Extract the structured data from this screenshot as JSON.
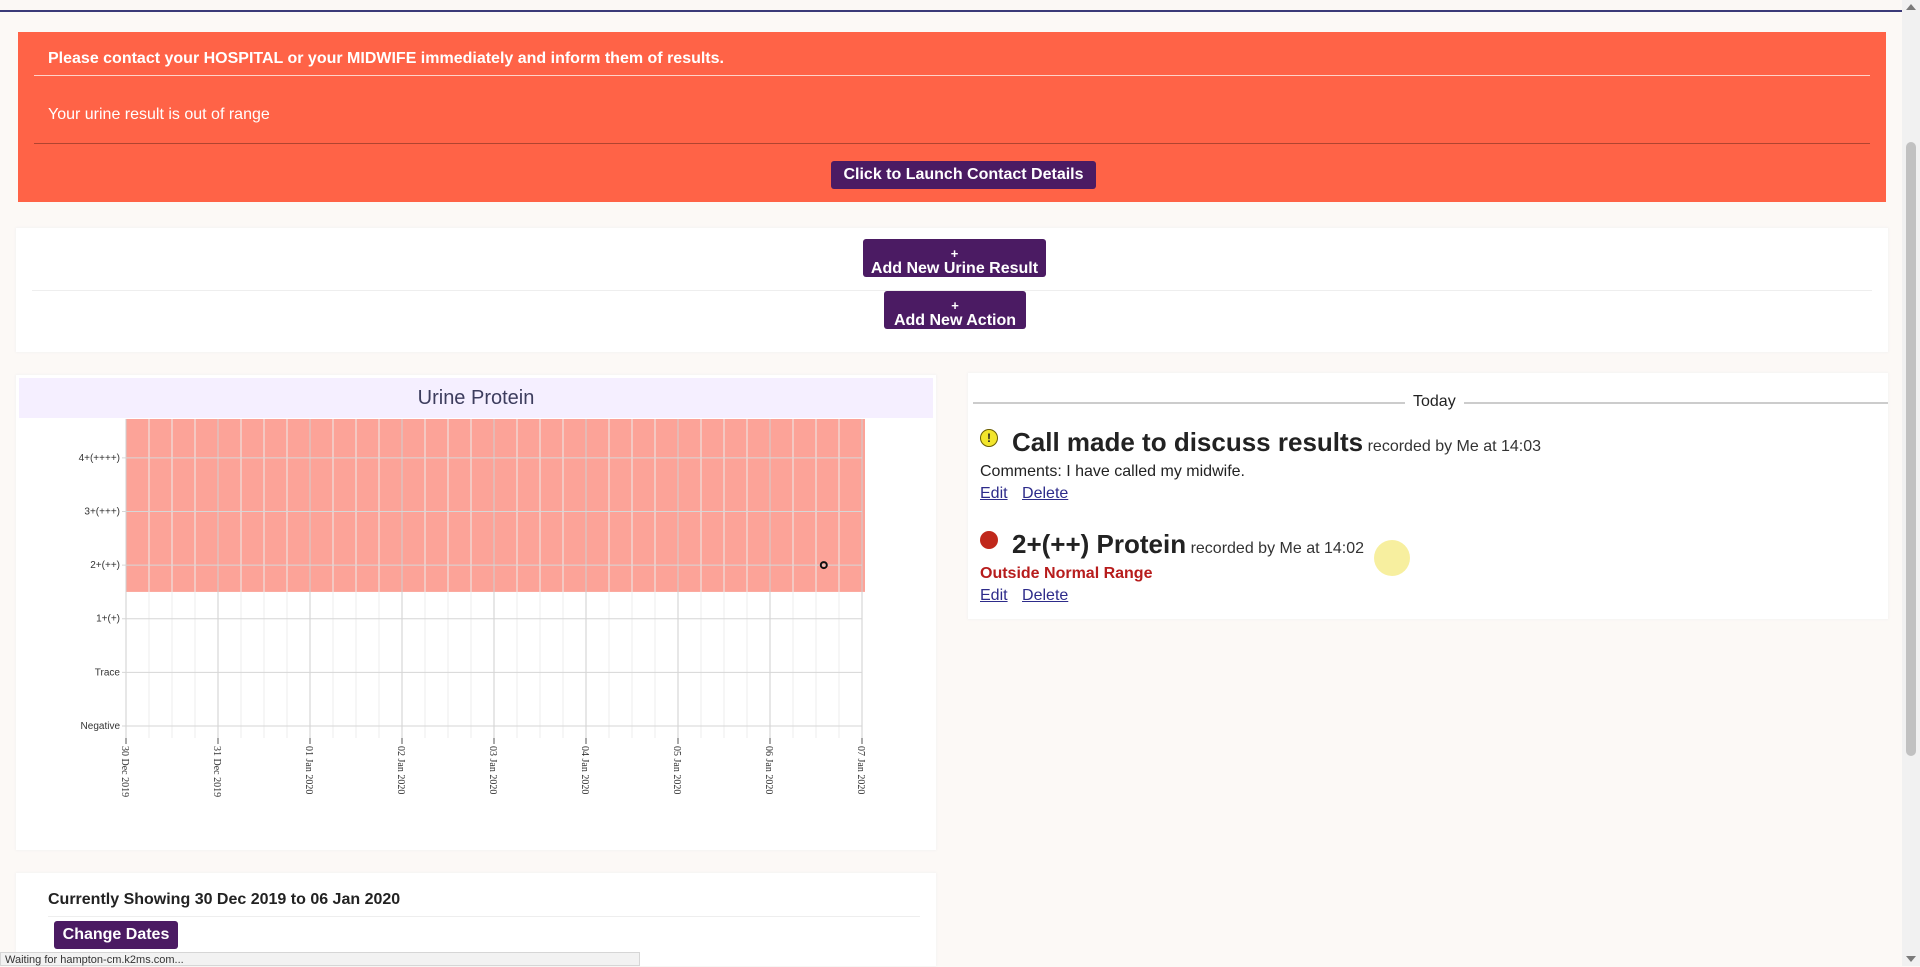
{
  "alert": {
    "line1": "Please contact your HOSPITAL or your MIDWIFE immediately and inform them of results.",
    "line2": "Your urine result is out of range",
    "button": "Click to Launch Contact Details",
    "color": "#ff6347"
  },
  "actions": {
    "add_urine": {
      "plus": "+",
      "label": "Add New Urine Result"
    },
    "add_action": {
      "plus": "+",
      "label": "Add New Action"
    }
  },
  "chart": {
    "title": "Urine Protein",
    "chart_data": {
      "type": "scatter",
      "title": "Urine Protein",
      "y_categories": [
        "Negative",
        "Trace",
        "1+(+)",
        "2+(++)",
        "3+(+++)",
        "4+(++++)"
      ],
      "x_ticks": [
        "30 Dec 2019",
        "31 Dec 2019",
        "01 Jan 2020",
        "02 Jan 2020",
        "03 Jan 2020",
        "04 Jan 2020",
        "05 Jan 2020",
        "06 Jan 2020",
        "07 Jan 2020"
      ],
      "out_of_range_band": {
        "from": "2+(++)",
        "to": "4+(++++)",
        "color": "#fca398"
      },
      "points": [
        {
          "x": "06 Jan 2020 14:02",
          "y": "2+(++)"
        }
      ],
      "grid": true
    }
  },
  "timeline": {
    "header": "Today",
    "events": [
      {
        "icon": "warning-icon",
        "icon_glyph": "!",
        "title": "Call made to discuss results",
        "recorded": "recorded by Me at 14:03",
        "comments": "Comments: I have called my midwife.",
        "edit": "Edit",
        "delete": "Delete"
      },
      {
        "icon": "red-dot-icon",
        "title": "2+(++) Protein",
        "recorded": "recorded by Me at 14:02",
        "range": "Outside Normal Range",
        "edit": "Edit",
        "delete": "Delete"
      }
    ]
  },
  "dates": {
    "showing_label": "Currently Showing",
    "range": "30 Dec 2019 to 06 Jan 2020",
    "button": "Change Dates"
  },
  "status_bar": "Waiting for hampton-cm.k2ms.com..."
}
